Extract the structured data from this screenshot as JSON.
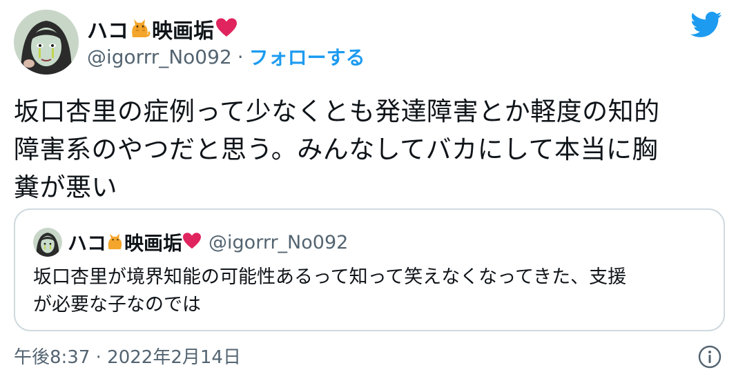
{
  "author": {
    "display_name": "ハコ",
    "name_suffix": "映画垢",
    "handle": "@igorrr_No092",
    "separator": "·",
    "follow_label": "フォローする"
  },
  "tweet": {
    "text": "坂口杏里の症例って少なくとも発達障害とか軽度の知的\n障害系のやつだと思う。みんなしてバカにして本当に胸\n糞が悪い",
    "timestamp": "午後8:37 · 2022年2月14日"
  },
  "quote": {
    "display_name": "ハコ",
    "name_suffix": "映画垢",
    "handle": "@igorrr_No092",
    "text": "坂口杏里が境界知能の可能性あるって知って笑えなくなってきた、支援\nが必要な子なのでは"
  },
  "icons": {
    "brand": "twitter-bird-icon",
    "name_emoji_1": "cat-icon",
    "name_emoji_2": "heart-icon",
    "info": "info-icon"
  },
  "colors": {
    "twitter_blue": "#1d9bf0",
    "secondary_text": "#536471",
    "border": "#cfd9de",
    "heart": "#e0245e"
  }
}
